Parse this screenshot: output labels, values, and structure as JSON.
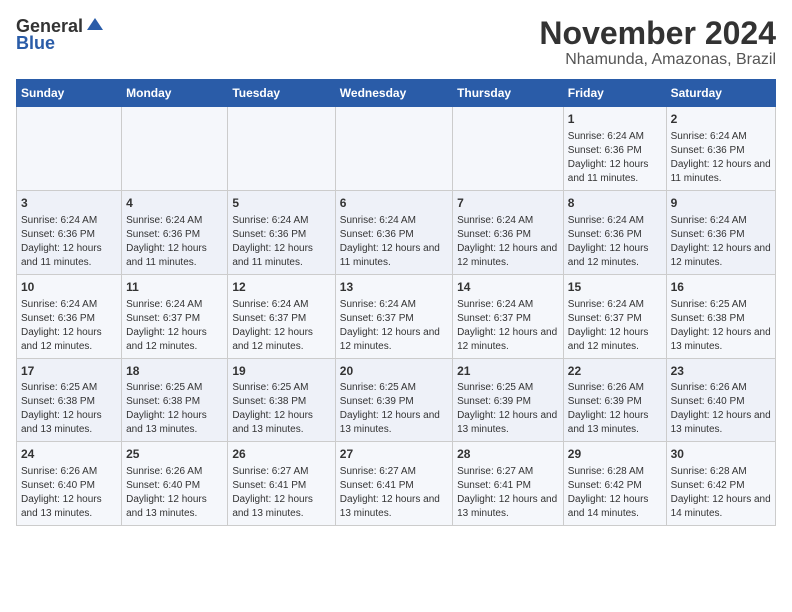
{
  "header": {
    "logo_general": "General",
    "logo_blue": "Blue",
    "title": "November 2024",
    "subtitle": "Nhamunda, Amazonas, Brazil"
  },
  "calendar": {
    "headers": [
      "Sunday",
      "Monday",
      "Tuesday",
      "Wednesday",
      "Thursday",
      "Friday",
      "Saturday"
    ],
    "weeks": [
      [
        {
          "day": "",
          "info": ""
        },
        {
          "day": "",
          "info": ""
        },
        {
          "day": "",
          "info": ""
        },
        {
          "day": "",
          "info": ""
        },
        {
          "day": "",
          "info": ""
        },
        {
          "day": "1",
          "info": "Sunrise: 6:24 AM\nSunset: 6:36 PM\nDaylight: 12 hours and 11 minutes."
        },
        {
          "day": "2",
          "info": "Sunrise: 6:24 AM\nSunset: 6:36 PM\nDaylight: 12 hours and 11 minutes."
        }
      ],
      [
        {
          "day": "3",
          "info": "Sunrise: 6:24 AM\nSunset: 6:36 PM\nDaylight: 12 hours and 11 minutes."
        },
        {
          "day": "4",
          "info": "Sunrise: 6:24 AM\nSunset: 6:36 PM\nDaylight: 12 hours and 11 minutes."
        },
        {
          "day": "5",
          "info": "Sunrise: 6:24 AM\nSunset: 6:36 PM\nDaylight: 12 hours and 11 minutes."
        },
        {
          "day": "6",
          "info": "Sunrise: 6:24 AM\nSunset: 6:36 PM\nDaylight: 12 hours and 11 minutes."
        },
        {
          "day": "7",
          "info": "Sunrise: 6:24 AM\nSunset: 6:36 PM\nDaylight: 12 hours and 12 minutes."
        },
        {
          "day": "8",
          "info": "Sunrise: 6:24 AM\nSunset: 6:36 PM\nDaylight: 12 hours and 12 minutes."
        },
        {
          "day": "9",
          "info": "Sunrise: 6:24 AM\nSunset: 6:36 PM\nDaylight: 12 hours and 12 minutes."
        }
      ],
      [
        {
          "day": "10",
          "info": "Sunrise: 6:24 AM\nSunset: 6:36 PM\nDaylight: 12 hours and 12 minutes."
        },
        {
          "day": "11",
          "info": "Sunrise: 6:24 AM\nSunset: 6:37 PM\nDaylight: 12 hours and 12 minutes."
        },
        {
          "day": "12",
          "info": "Sunrise: 6:24 AM\nSunset: 6:37 PM\nDaylight: 12 hours and 12 minutes."
        },
        {
          "day": "13",
          "info": "Sunrise: 6:24 AM\nSunset: 6:37 PM\nDaylight: 12 hours and 12 minutes."
        },
        {
          "day": "14",
          "info": "Sunrise: 6:24 AM\nSunset: 6:37 PM\nDaylight: 12 hours and 12 minutes."
        },
        {
          "day": "15",
          "info": "Sunrise: 6:24 AM\nSunset: 6:37 PM\nDaylight: 12 hours and 12 minutes."
        },
        {
          "day": "16",
          "info": "Sunrise: 6:25 AM\nSunset: 6:38 PM\nDaylight: 12 hours and 13 minutes."
        }
      ],
      [
        {
          "day": "17",
          "info": "Sunrise: 6:25 AM\nSunset: 6:38 PM\nDaylight: 12 hours and 13 minutes."
        },
        {
          "day": "18",
          "info": "Sunrise: 6:25 AM\nSunset: 6:38 PM\nDaylight: 12 hours and 13 minutes."
        },
        {
          "day": "19",
          "info": "Sunrise: 6:25 AM\nSunset: 6:38 PM\nDaylight: 12 hours and 13 minutes."
        },
        {
          "day": "20",
          "info": "Sunrise: 6:25 AM\nSunset: 6:39 PM\nDaylight: 12 hours and 13 minutes."
        },
        {
          "day": "21",
          "info": "Sunrise: 6:25 AM\nSunset: 6:39 PM\nDaylight: 12 hours and 13 minutes."
        },
        {
          "day": "22",
          "info": "Sunrise: 6:26 AM\nSunset: 6:39 PM\nDaylight: 12 hours and 13 minutes."
        },
        {
          "day": "23",
          "info": "Sunrise: 6:26 AM\nSunset: 6:40 PM\nDaylight: 12 hours and 13 minutes."
        }
      ],
      [
        {
          "day": "24",
          "info": "Sunrise: 6:26 AM\nSunset: 6:40 PM\nDaylight: 12 hours and 13 minutes."
        },
        {
          "day": "25",
          "info": "Sunrise: 6:26 AM\nSunset: 6:40 PM\nDaylight: 12 hours and 13 minutes."
        },
        {
          "day": "26",
          "info": "Sunrise: 6:27 AM\nSunset: 6:41 PM\nDaylight: 12 hours and 13 minutes."
        },
        {
          "day": "27",
          "info": "Sunrise: 6:27 AM\nSunset: 6:41 PM\nDaylight: 12 hours and 13 minutes."
        },
        {
          "day": "28",
          "info": "Sunrise: 6:27 AM\nSunset: 6:41 PM\nDaylight: 12 hours and 13 minutes."
        },
        {
          "day": "29",
          "info": "Sunrise: 6:28 AM\nSunset: 6:42 PM\nDaylight: 12 hours and 14 minutes."
        },
        {
          "day": "30",
          "info": "Sunrise: 6:28 AM\nSunset: 6:42 PM\nDaylight: 12 hours and 14 minutes."
        }
      ]
    ]
  }
}
